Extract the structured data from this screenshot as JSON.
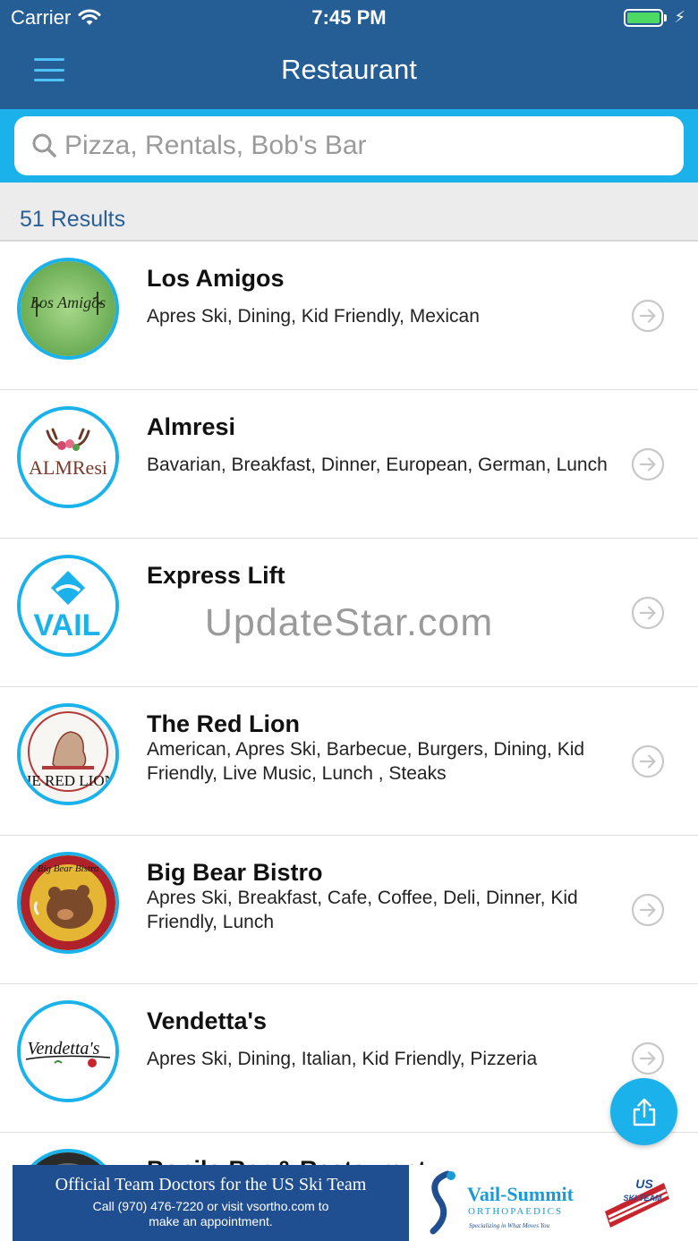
{
  "status_bar": {
    "carrier": "Carrier",
    "time": "7:45 PM"
  },
  "nav": {
    "title": "Restaurant"
  },
  "search": {
    "placeholder": "Pizza, Rentals, Bob's Bar",
    "value": ""
  },
  "results": {
    "count_label": "51 Results"
  },
  "items": [
    {
      "title": "Los Amigos",
      "tags": "Apres Ski, Dining, Kid Friendly, Mexican",
      "logo_text": "Los Amigos"
    },
    {
      "title": "Almresi",
      "tags": "Bavarian, Breakfast, Dinner, European, German, Lunch",
      "logo_text": "ALMResi"
    },
    {
      "title": "Express Lift",
      "tags": "",
      "logo_text": "VAIL"
    },
    {
      "title": "The Red Lion",
      "tags": "American, Apres Ski, Barbecue, Burgers, Dining, Kid Friendly, Live Music, Lunch , Steaks",
      "logo_text": "HE RED LION"
    },
    {
      "title": "Big Bear Bistro",
      "tags": "Apres Ski, Breakfast, Cafe, Coffee, Deli, Dinner, Kid Friendly, Lunch",
      "logo_text": "Big Bear Bistro"
    },
    {
      "title": "Vendetta's",
      "tags": "Apres Ski, Dining, Italian, Kid Friendly, Pizzeria",
      "logo_text": "Vendetta's"
    },
    {
      "title": "Bonilo Bar & Restaurant",
      "tags": "",
      "logo_text": ""
    }
  ],
  "watermark": "UpdateStar.com",
  "ad": {
    "headline": "Official Team Doctors for the US Ski Team",
    "sub_line1": "Call (970) 476-7220 or visit vsortho.com to",
    "sub_line2": "make an appointment.",
    "brand_name": "Vail-Summit",
    "brand_sub": "ORTHOPAEDICS",
    "brand_tagline": "Specializing in What Moves You",
    "flag_text_1": "US",
    "flag_text_2": "SKI TEAM"
  },
  "colors": {
    "nav_bar": "#255d95",
    "accent": "#1bb1ea",
    "results_text": "#2b5f96",
    "ad_background": "#1f4e91"
  },
  "icons": {
    "menu": "hamburger-icon",
    "search": "magnifier-icon",
    "row_action": "arrow-right-circle-icon",
    "fab": "share-icon"
  }
}
